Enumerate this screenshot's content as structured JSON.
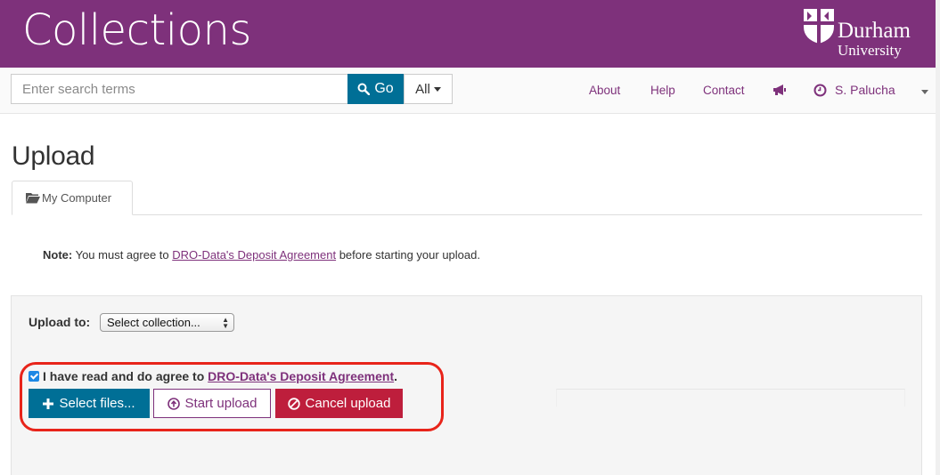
{
  "header": {
    "app_title": "Collections",
    "logo": {
      "line1": "Durham",
      "line2": "University",
      "icon": "durham-shield-logo"
    },
    "brand_color": "#7e317b"
  },
  "navbar": {
    "search": {
      "placeholder": "Enter search terms",
      "value": ""
    },
    "go_label": "Go",
    "scope_label": "All",
    "links": {
      "about": "About",
      "help": "Help",
      "contact": "Contact"
    },
    "user_name": "S. Palucha",
    "icons": {
      "search": "search-icon",
      "announce": "megaphone-icon",
      "user": "clock-icon"
    }
  },
  "page": {
    "title": "Upload",
    "tab_label": "My Computer",
    "note": {
      "bold": "Note:",
      "pre": " You must agree to ",
      "link": "DRO-Data's Deposit Agreement",
      "post": " before starting your upload."
    }
  },
  "upload": {
    "upload_to_label": "Upload to:",
    "collection_selected": "Select collection...",
    "agree_checked": true,
    "agree_pre": "I have read and do agree to ",
    "agree_link": "DRO-Data's Deposit Agreement",
    "agree_post": ".",
    "select_files_label": "Select files...",
    "start_upload_label": "Start upload",
    "cancel_upload_label": "Cancel upload"
  },
  "colors": {
    "primary_blue": "#006f96",
    "danger_red": "#be1e3c",
    "highlight_red": "#e8241a"
  }
}
